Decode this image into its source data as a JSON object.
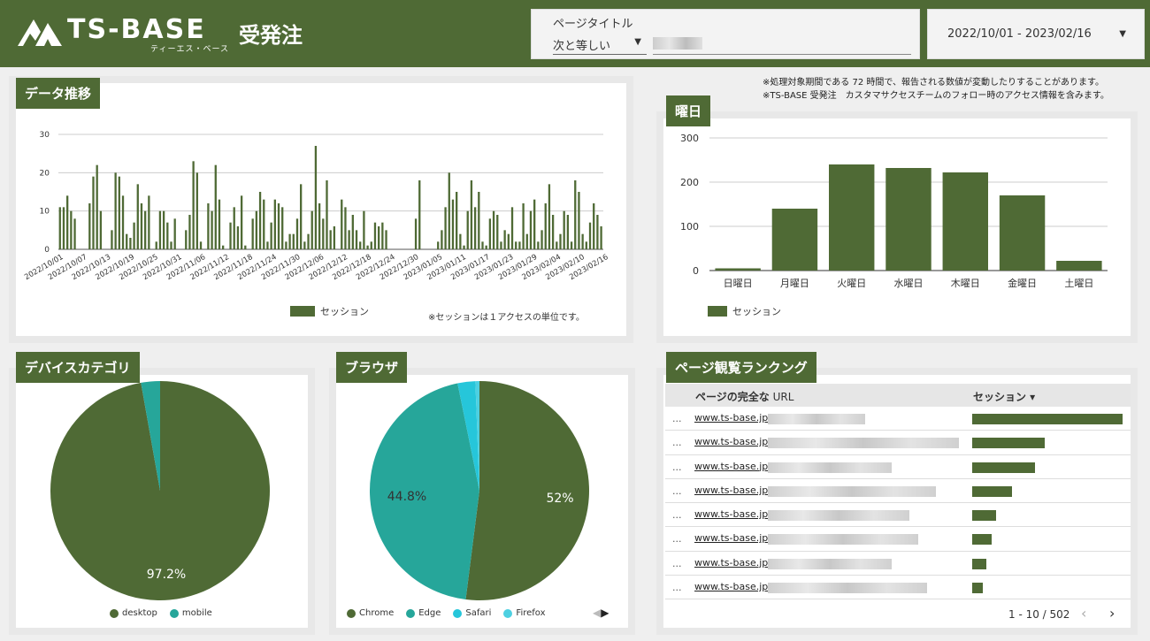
{
  "header": {
    "logo_text": "TS-BASE",
    "logo_suffix": "受発注",
    "logo_sub": "ティーエス・ベース",
    "filter_label": "ページタイトル",
    "filter_operator": "次と等しい",
    "date_range": "2022/10/01 - 2023/02/16"
  },
  "notes": [
    "※処理対象期間である 72 時間で、報告される数値が変動したりすることがあります。",
    "※TS-BASE 受発注　カスタマサクセスチームのフォロー時のアクセス情報を含みます。"
  ],
  "panels": {
    "trend": "データ推移",
    "weekday": "曜日",
    "device": "デバイスカテゴリ",
    "browser": "ブラウザ",
    "ranking": "ページ観覧ランクング"
  },
  "trend_legend": "セッション",
  "trend_note": "※セッションは１アクセスの単位です。",
  "weekday_legend": "セッション",
  "colors": {
    "primary": "#4f6a35",
    "teal": "#26a69a",
    "cyan": "#26c6da",
    "light_teal": "#4dd0e1"
  },
  "chart_data": [
    {
      "type": "bar",
      "title": "データ推移",
      "ylim": [
        0,
        30
      ],
      "yticks": [
        0,
        10,
        20,
        30
      ],
      "xticks": [
        "2022/10/01",
        "2022/10/07",
        "2022/10/13",
        "2022/10/19",
        "2022/10/25",
        "2022/10/31",
        "2022/11/06",
        "2022/11/12",
        "2022/11/18",
        "2022/11/24",
        "2022/11/30",
        "2022/12/06",
        "2022/12/12",
        "2022/12/18",
        "2022/12/24",
        "2022/12/30",
        "2023/01/05",
        "2023/01/11",
        "2023/01/17",
        "2023/01/23",
        "2023/01/29",
        "2023/02/04",
        "2023/02/10",
        "2023/02/16"
      ],
      "series": [
        {
          "name": "セッション",
          "values": [
            11,
            11,
            14,
            10,
            8,
            0,
            0,
            0,
            12,
            19,
            22,
            10,
            0,
            0,
            5,
            20,
            19,
            14,
            4,
            3,
            7,
            17,
            12,
            10,
            14,
            0,
            2,
            10,
            10,
            7,
            2,
            8,
            0,
            0,
            5,
            9,
            23,
            20,
            2,
            0,
            12,
            10,
            22,
            13,
            1,
            0,
            7,
            11,
            6,
            14,
            1,
            0,
            8,
            10,
            15,
            13,
            2,
            7,
            13,
            12,
            11,
            2,
            4,
            4,
            8,
            17,
            2,
            4,
            10,
            27,
            12,
            8,
            18,
            5,
            6,
            0,
            13,
            11,
            5,
            9,
            5,
            2,
            10,
            1,
            2,
            7,
            6,
            7,
            5,
            0,
            0,
            0,
            0,
            0,
            0,
            0,
            8,
            18,
            0,
            0,
            0,
            0,
            2,
            5,
            11,
            20,
            13,
            15,
            4,
            1,
            10,
            18,
            11,
            15,
            2,
            1,
            8,
            10,
            9,
            2,
            5,
            4,
            11,
            2,
            2,
            12,
            4,
            10,
            13,
            2,
            5,
            12,
            17,
            9,
            2,
            4,
            10,
            9,
            2,
            18,
            15,
            4,
            2,
            7,
            12,
            9,
            6
          ]
        }
      ],
      "grid": true,
      "legend": "bottom"
    },
    {
      "type": "bar",
      "title": "曜日",
      "categories": [
        "日曜日",
        "月曜日",
        "火曜日",
        "水曜日",
        "木曜日",
        "金曜日",
        "土曜日"
      ],
      "series": [
        {
          "name": "セッション",
          "values": [
            5,
            140,
            240,
            232,
            222,
            170,
            22
          ]
        }
      ],
      "ylim": [
        0,
        300
      ],
      "yticks": [
        0,
        100,
        200,
        300
      ],
      "grid": true,
      "legend": "bottom"
    },
    {
      "type": "pie",
      "title": "デバイスカテゴリ",
      "labels": [
        "desktop",
        "mobile"
      ],
      "values": [
        97.2,
        2.8
      ],
      "value_labels": [
        "97.2%",
        ""
      ],
      "legend": "bottom"
    },
    {
      "type": "pie",
      "title": "ブラウザ",
      "labels": [
        "Chrome",
        "Edge",
        "Safari",
        "Firefox"
      ],
      "values": [
        52,
        44.8,
        2.6,
        0.6
      ],
      "value_labels": [
        "52%",
        "44.8%",
        "",
        ""
      ],
      "legend": "bottom"
    }
  ],
  "ranking": {
    "col_url_bold": "ページの完全な",
    "col_url_rest": " URL",
    "col_sessions": "セッション ▾",
    "rows": [
      {
        "dots": "...",
        "url": "www.ts-base.jp/",
        "value": 170
      },
      {
        "dots": "...",
        "url": "www.ts-base.jp/",
        "value": 82
      },
      {
        "dots": "...",
        "url": "www.ts-base.jp/",
        "value": 71
      },
      {
        "dots": "...",
        "url": "www.ts-base.jp/",
        "value": 45
      },
      {
        "dots": "...",
        "url": "www.ts-base.jp/",
        "value": 27
      },
      {
        "dots": "...",
        "url": "www.ts-base.jp/",
        "value": 22
      },
      {
        "dots": "...",
        "url": "www.ts-base.jp/",
        "value": 16
      },
      {
        "dots": "...",
        "url": "www.ts-base.jp/",
        "value": 12
      }
    ],
    "pager": "1 - 10 / 502",
    "prev": "‹",
    "next": "›"
  }
}
